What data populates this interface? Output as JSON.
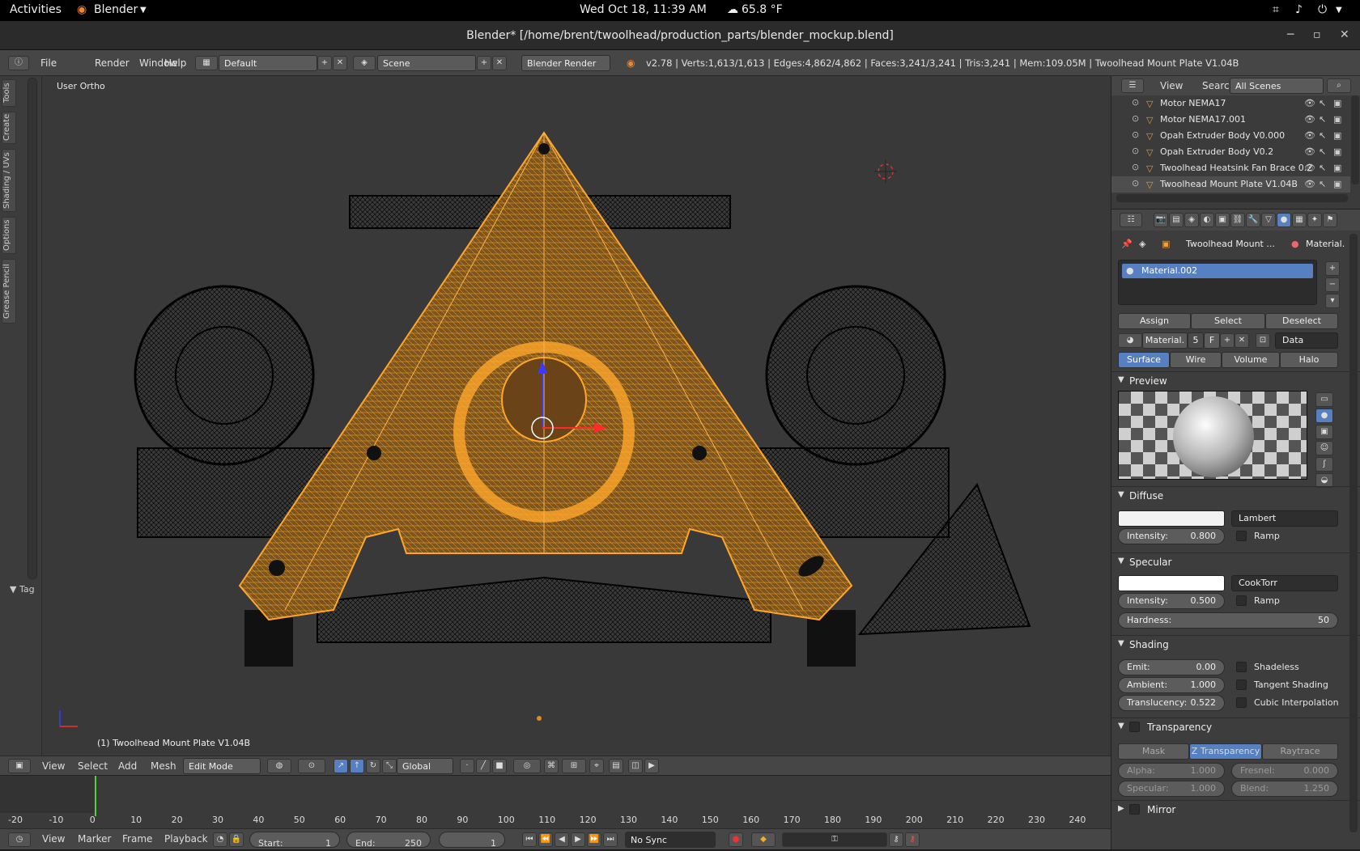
{
  "topbar": {
    "activities": "Activities",
    "app": "Blender",
    "datetime": "Wed Oct 18, 11:39 AM",
    "weather": "65.8 °F"
  },
  "window": {
    "title": "Blender* [/home/brent/twoolhead/production_parts/blender_mockup.blend]"
  },
  "menu": {
    "file": "File",
    "render": "Render",
    "window": "Window",
    "help": "Help",
    "layout": "Default",
    "scene": "Scene",
    "engine": "Blender Render"
  },
  "stats": "v2.78 | Verts:1,613/1,613 | Edges:4,862/4,862 | Faces:3,241/3,241 | Tris:3,241 | Mem:109.05M | Twoolhead Mount Plate V1.04B",
  "toolshelf": {
    "tabs": [
      "Tools",
      "Create",
      "Shading / UVs",
      "Options",
      "Grease Pencil"
    ],
    "tag": "Tag"
  },
  "viewport": {
    "view_label": "User Ortho",
    "object_label": "(1) Twoolhead Mount Plate V1.04B"
  },
  "view3d_header": {
    "view": "View",
    "select": "Select",
    "add": "Add",
    "mesh": "Mesh",
    "mode": "Edit Mode",
    "orientation": "Global"
  },
  "timeline": {
    "ticks": [
      "-20",
      "-10",
      "0",
      "10",
      "20",
      "30",
      "40",
      "50",
      "60",
      "70",
      "80",
      "90",
      "100",
      "110",
      "120",
      "130",
      "140",
      "150",
      "160",
      "170",
      "180",
      "190",
      "200",
      "210",
      "220",
      "230",
      "240"
    ],
    "current_frame_marker": 0
  },
  "timeline_header": {
    "view": "View",
    "marker": "Marker",
    "frame": "Frame",
    "playback": "Playback",
    "start_label": "Start:",
    "start": "1",
    "end_label": "End:",
    "end": "250",
    "current": "1",
    "sync": "No Sync"
  },
  "outliner": {
    "view": "View",
    "search": "Search",
    "filter": "All Scenes",
    "items": [
      "Motor NEMA17",
      "Motor NEMA17.001",
      "Opah Extruder Body V0.000",
      "Opah Extruder Body V0.2",
      "Twoolhead Heatsink Fan Brace 0.2",
      "Twoolhead Mount Plate V1.04B"
    ]
  },
  "properties": {
    "breadcrumb_object": "Twoolhead Mount ...",
    "breadcrumb_material": "Material.",
    "slot": "Material.002",
    "assign": "Assign",
    "select": "Select",
    "deselect": "Deselect",
    "mat_name": "Material.",
    "users": "5",
    "fake": "F",
    "link": "Data",
    "tabs": [
      "Surface",
      "Wire",
      "Volume",
      "Halo"
    ],
    "preview": "Preview",
    "diffuse": {
      "title": "Diffuse",
      "shader": "Lambert",
      "intensity_label": "Intensity:",
      "intensity": "0.800",
      "ramp": "Ramp",
      "color": "#f2f2f2"
    },
    "specular": {
      "title": "Specular",
      "shader": "CookTorr",
      "intensity_label": "Intensity:",
      "intensity": "0.500",
      "ramp": "Ramp",
      "hardness_label": "Hardness:",
      "hardness": "50",
      "color": "#ffffff"
    },
    "shading": {
      "title": "Shading",
      "emit_label": "Emit:",
      "emit": "0.00",
      "ambient_label": "Ambient:",
      "ambient": "1.000",
      "translucency_label": "Translucency:",
      "translucency": "0.522",
      "shadeless": "Shadeless",
      "tangent": "Tangent Shading",
      "cubic": "Cubic Interpolation"
    },
    "transparency": {
      "title": "Transparency",
      "modes": [
        "Mask",
        "Z Transparency",
        "Raytrace"
      ],
      "alpha_label": "Alpha:",
      "alpha": "1.000",
      "fresnel_label": "Fresnel:",
      "fresnel": "0.000",
      "specular_label": "Specular:",
      "specular": "1.000",
      "blend_label": "Blend:",
      "blend": "1.250"
    },
    "mirror": "Mirror"
  },
  "colors": {
    "selection": "#f5a020",
    "accent": "#5680c2"
  }
}
